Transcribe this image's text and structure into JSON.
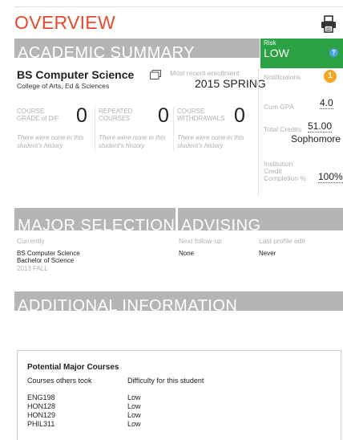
{
  "header": {
    "title": "OVERVIEW",
    "print_icon": "printer-icon"
  },
  "academic_summary": {
    "heading": "ACADEMIC SUMMARY",
    "degree": "BS Computer Science",
    "college": "College of Arts, Ed & Sciences",
    "copy_icon": "copy-icon",
    "enrollment_label": "Most recent enrollment",
    "enrollment_value": "2015 SPRING",
    "stats": [
      {
        "label_line1": "COURSE",
        "label_line2": "GRADE of D/F",
        "value": "0",
        "note": "There were none in this student's history"
      },
      {
        "label_line1": "REPEATED",
        "label_line2": "COURSES",
        "value": "0",
        "note": "There were none in this student's history"
      },
      {
        "label_line1": "COURSE",
        "label_line2": "WITHDRAWALS",
        "value": "0",
        "note": "There were none in this student's history"
      }
    ]
  },
  "risk": {
    "label": "Risk",
    "value": "LOW",
    "help": "?",
    "color": "#2aa142"
  },
  "side": {
    "notifications_label": "Notifications",
    "notifications_count": "1",
    "gpa_label": "Cum GPA",
    "gpa_value": "4.0",
    "credits_label": "Total Credits",
    "credits_value": "51.00",
    "class_level": "Sophomore",
    "completion_label_1": "Institution",
    "completion_label_2": "Credit",
    "completion_label_3": "Completion %",
    "completion_value": "100%"
  },
  "major_selection": {
    "heading": "MAJOR SELECTION",
    "currently_label": "Currently",
    "major": "BS Computer Science",
    "degree": "Bachelor of Science",
    "term": "2013 FALL"
  },
  "advising": {
    "heading": "ADVISING",
    "followup_label": "Next follow-up",
    "followup_value": "None",
    "last_edit_label": "Last profile edit",
    "last_edit_value": "Never"
  },
  "additional": {
    "heading": "ADDITIONAL INFORMATION"
  },
  "potential_courses": {
    "title": "Potential Major Courses",
    "col_course": "Courses others took",
    "col_difficulty": "Difficulty for this student",
    "rows": [
      {
        "course": "ENG198",
        "difficulty": "Low"
      },
      {
        "course": "HON128",
        "difficulty": "Low"
      },
      {
        "course": "HON129",
        "difficulty": "Low"
      },
      {
        "course": "PHIL311",
        "difficulty": "Low"
      }
    ]
  },
  "colors": {
    "accent": "#e8492d",
    "bar": "#b5b5b5",
    "badge": "#f5a623",
    "help": "#4aa3df"
  }
}
